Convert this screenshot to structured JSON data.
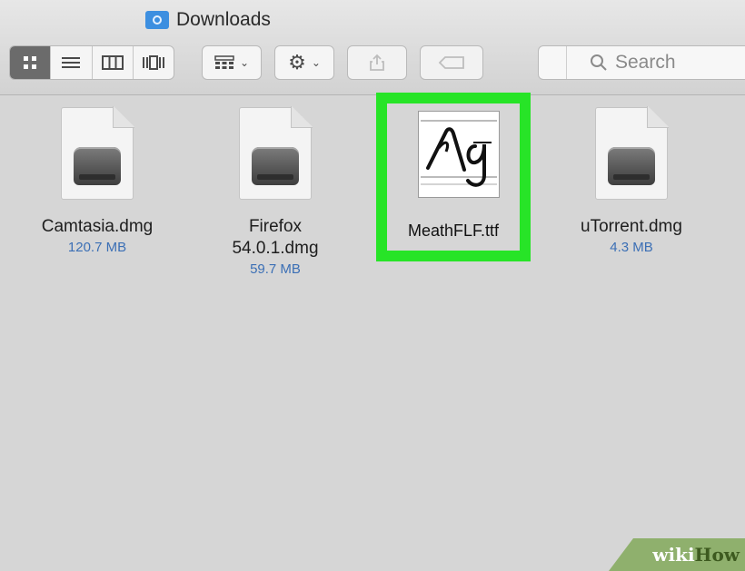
{
  "window": {
    "title": "Downloads"
  },
  "toolbar": {
    "view_buttons": [
      "icon-view",
      "list-view",
      "column-view",
      "cover-flow-view"
    ],
    "search_placeholder": "Search"
  },
  "files": [
    {
      "name": "Camtasia.dmg",
      "size": "120.7 MB",
      "icon": "disk-image-icon"
    },
    {
      "name": "Firefox 54.0.1.dmg",
      "size": "59.7 MB",
      "icon": "disk-image-icon"
    },
    {
      "name": "MeathFLF.ttf",
      "size": "",
      "icon": "font-file-icon",
      "selected": true
    },
    {
      "name": "uTorrent.dmg",
      "size": "4.3 MB",
      "icon": "disk-image-icon"
    }
  ],
  "firefox_name_lines": [
    "Firefox",
    "54.0.1.dmg"
  ],
  "watermark": {
    "part1": "wiki",
    "part2": "How"
  },
  "colors": {
    "highlight": "#27e427",
    "size_text": "#3b6fb5",
    "window_bg": "#d6d6d6"
  }
}
